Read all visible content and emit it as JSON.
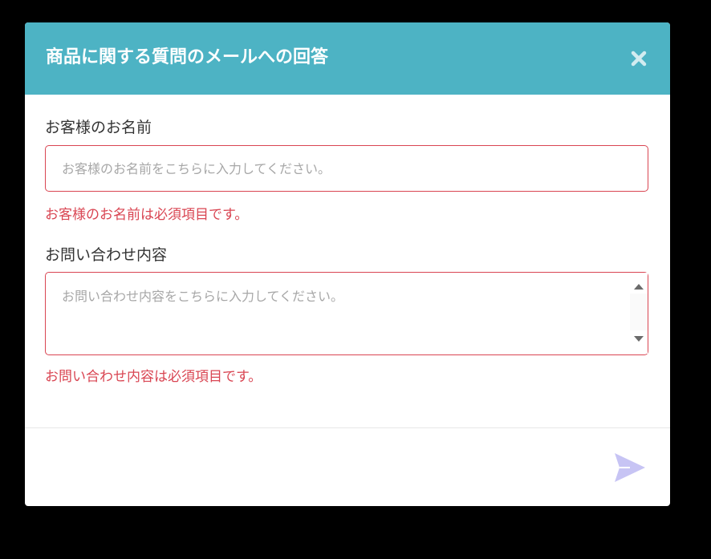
{
  "modal": {
    "title": "商品に関する質問のメールへの回答",
    "close_icon": "close-icon",
    "header_color": "#4db3c4"
  },
  "form": {
    "name_field": {
      "label": "お客様のお名前",
      "value": "",
      "placeholder": "お客様のお名前をこちらに入力してください。",
      "error": "お客様のお名前は必須項目です。"
    },
    "inquiry_field": {
      "label": "お問い合わせ内容",
      "value": "",
      "placeholder": "お問い合わせ内容をこちらに入力してください。",
      "error": "お問い合わせ内容は必須項目です。"
    }
  },
  "footer": {
    "send_icon": "send-icon",
    "send_color": "#c7c4f4"
  },
  "colors": {
    "error": "#d94552",
    "backdrop": "#000000"
  }
}
